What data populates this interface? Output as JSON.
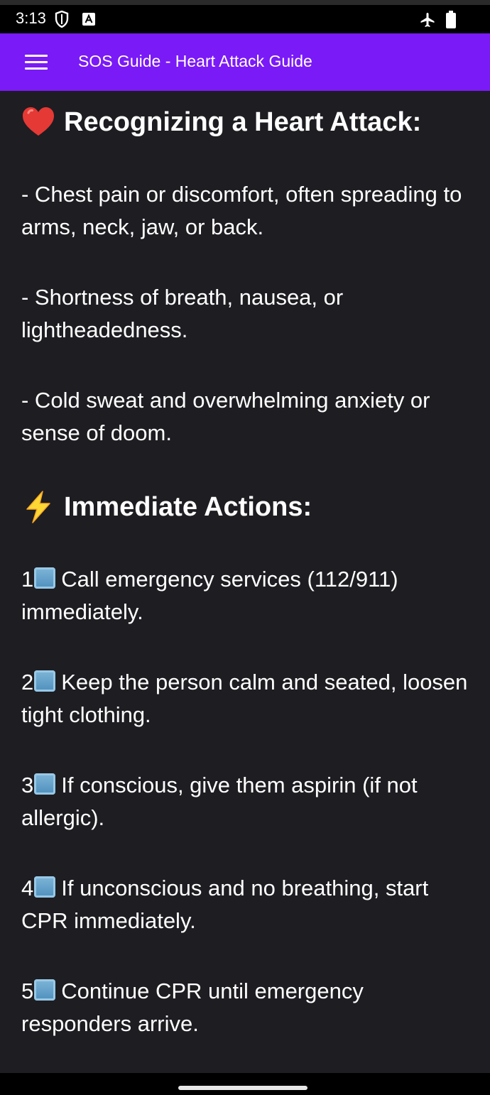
{
  "status_bar": {
    "time": "3:13",
    "icons": [
      "shield-icon",
      "font-a-icon",
      "airplane-mode-icon",
      "battery-icon"
    ]
  },
  "app_bar": {
    "title": "SOS Guide - Heart Attack Guide",
    "menu_icon": "hamburger-menu-icon",
    "background": "#7a1af7"
  },
  "content": {
    "section1": {
      "icon": "red-heart-icon",
      "heading": "Recognizing a Heart Attack:",
      "items": [
        "- Chest pain or discomfort, often spreading to arms, neck, jaw, or back.",
        "- Shortness of breath, nausea, or lightheadedness.",
        "- Cold sweat and overwhelming anxiety or sense of doom."
      ]
    },
    "section2": {
      "icon": "lightning-icon",
      "heading": "Immediate Actions:",
      "steps": [
        {
          "number": "1",
          "text": "Call emergency services (112/911) immediately."
        },
        {
          "number": "2",
          "text": "Keep the person calm and seated, loosen tight clothing."
        },
        {
          "number": "3",
          "text": "If conscious, give them aspirin (if not allergic)."
        },
        {
          "number": "4",
          "text": "If unconscious and no breathing, start CPR immediately."
        },
        {
          "number": "5",
          "text": "Continue CPR until emergency responders arrive."
        }
      ]
    }
  },
  "colors": {
    "content_background": "#1e1d22",
    "text": "#ffffff"
  }
}
